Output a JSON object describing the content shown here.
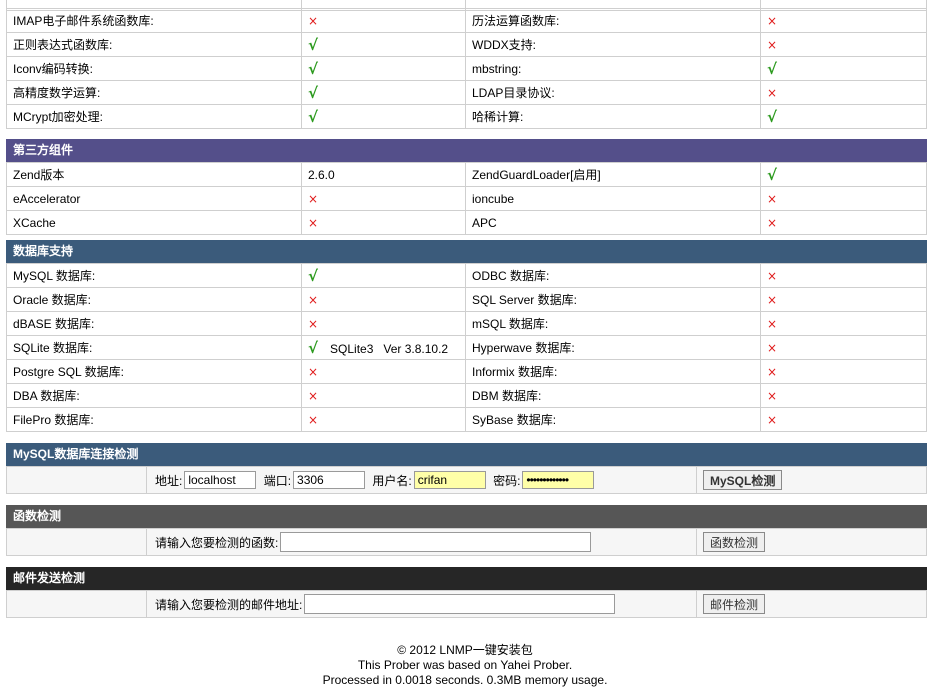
{
  "top_partial": {
    "cells": [
      "",
      "",
      "",
      ""
    ]
  },
  "features": [
    {
      "l_label": "IMAP电子邮件系统函数库:",
      "l_mark": "×",
      "r_label": "历法运算函数库:",
      "r_mark": "×"
    },
    {
      "l_label": "正则表达式函数库:",
      "l_mark": "√",
      "r_label": "WDDX支持:",
      "r_mark": "×"
    },
    {
      "l_label": "Iconv编码转换:",
      "l_mark": "√",
      "r_label": "mbstring:",
      "r_mark": "√"
    },
    {
      "l_label": "高精度数学运算:",
      "l_mark": "√",
      "r_label": "LDAP目录协议:",
      "r_mark": "×"
    },
    {
      "l_label": "MCrypt加密处理:",
      "l_mark": "√",
      "r_label": "哈稀计算:",
      "r_mark": "√"
    }
  ],
  "third_party": {
    "title": "第三方组件",
    "rows": [
      {
        "l_label": "Zend版本",
        "l_value": "2.6.0",
        "r_label": "ZendGuardLoader[启用]",
        "r_mark": "√"
      },
      {
        "l_label": "eAccelerator",
        "l_mark": "×",
        "r_label": "ioncube",
        "r_mark": "×"
      },
      {
        "l_label": "XCache",
        "l_mark": "×",
        "r_label": "APC",
        "r_mark": "×"
      }
    ]
  },
  "database": {
    "title": "数据库支持",
    "rows": [
      {
        "l_label": "MySQL 数据库:",
        "l_mark": "√",
        "r_label": "ODBC 数据库:",
        "r_mark": "×"
      },
      {
        "l_label": "Oracle 数据库:",
        "l_mark": "×",
        "r_label": "SQL Server 数据库:",
        "r_mark": "×"
      },
      {
        "l_label": "dBASE 数据库:",
        "l_mark": "×",
        "r_label": "mSQL 数据库:",
        "r_mark": "×"
      },
      {
        "l_label": "SQLite 数据库:",
        "l_mark": "√",
        "l_extra": "SQLite3   Ver 3.8.10.2",
        "r_label": "Hyperwave 数据库:",
        "r_mark": "×"
      },
      {
        "l_label": "Postgre SQL 数据库:",
        "l_mark": "×",
        "r_label": "Informix 数据库:",
        "r_mark": "×"
      },
      {
        "l_label": "DBA 数据库:",
        "l_mark": "×",
        "r_label": "DBM 数据库:",
        "r_mark": "×"
      },
      {
        "l_label": "FilePro 数据库:",
        "l_mark": "×",
        "r_label": "SyBase 数据库:",
        "r_mark": "×"
      }
    ]
  },
  "mysql_check": {
    "title": "MySQL数据库连接检测",
    "host_label": "地址:",
    "host_value": "localhost",
    "port_label": "端口:",
    "port_value": "3306",
    "user_label": "用户名:",
    "user_value": "crifan",
    "pass_label": "密码:",
    "pass_value": "•••••••••••••",
    "button": "MySQL检测"
  },
  "func_check": {
    "title": "函数检测",
    "prompt": "请输入您要检测的函数:",
    "value": "",
    "button": "函数检测"
  },
  "mail_check": {
    "title": "邮件发送检测",
    "prompt": "请输入您要检测的邮件地址:",
    "value": "",
    "button": "邮件检测"
  },
  "footer": {
    "line1": "© 2012 LNMP一键安装包",
    "line2": "This Prober was based on Yahei Prober.",
    "line3": "Processed in 0.0018 seconds. 0.3MB memory usage."
  },
  "colors": {
    "yes": "#2c9a1e",
    "no": "#e01b1b",
    "third_header": "#544f8a",
    "db_header": "#3b5b7b",
    "func_header": "#565656",
    "mail_header": "#262626"
  }
}
